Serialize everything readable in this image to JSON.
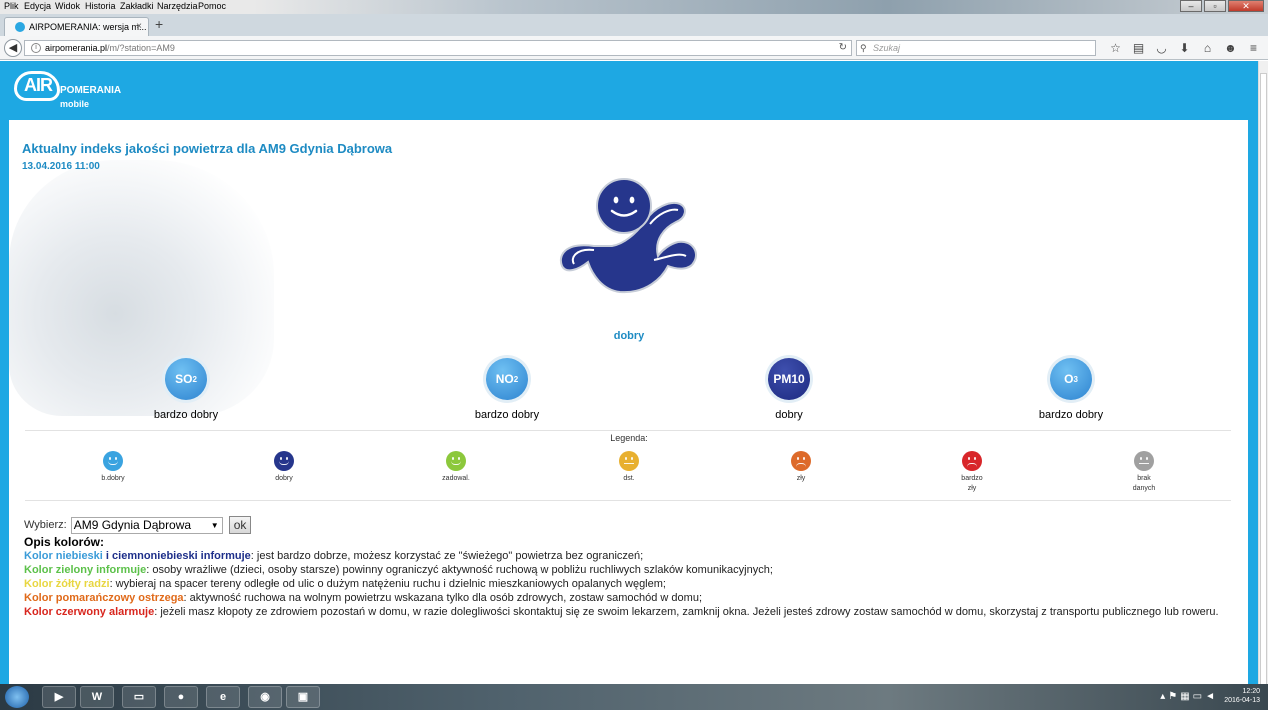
{
  "menubar": {
    "items": [
      "Plik",
      "Edycja",
      "Widok",
      "Historia",
      "Zakładki",
      "Narzędzia",
      "Pomoc"
    ]
  },
  "tab": {
    "title": "AIRPOMERANIA: wersja m...",
    "close": "×",
    "new": "+"
  },
  "address": {
    "host": "airpomerania.pl",
    "path": "/m/?station=AM9"
  },
  "search": {
    "placeholder": "Szukaj"
  },
  "logo": {
    "air": "AIR",
    "pomerania": "POMERANIA",
    "mobile": "mobile"
  },
  "page": {
    "title": "Aktualny indeks jakości powietrza dla AM9 Gdynia Dąbrowa",
    "date": "13.04.2016 11:00",
    "main_status": "dobry"
  },
  "pollutants": [
    {
      "name": "SO",
      "sub": "2",
      "status": "bardzo dobry",
      "level": "very-good"
    },
    {
      "name": "NO",
      "sub": "2",
      "status": "bardzo dobry",
      "level": "very-good"
    },
    {
      "name": "PM10",
      "sub": "",
      "status": "dobry",
      "level": "good"
    },
    {
      "name": "O",
      "sub": "3",
      "status": "bardzo dobry",
      "level": "very-good"
    }
  ],
  "legend": {
    "title": "Legenda:",
    "items": [
      {
        "label": "b.dobry",
        "label2": "",
        "color": "#3aa3e0"
      },
      {
        "label": "dobry",
        "label2": "",
        "color": "#26368c"
      },
      {
        "label": "zadowal.",
        "label2": "",
        "color": "#8cc83c"
      },
      {
        "label": "dst.",
        "label2": "",
        "color": "#e8b030"
      },
      {
        "label": "zły",
        "label2": "",
        "color": "#dd6a2a"
      },
      {
        "label": "bardzo",
        "label2": "zły",
        "color": "#d8262a"
      },
      {
        "label": "brak",
        "label2": "danych",
        "color": "#a0a0a0"
      }
    ]
  },
  "form": {
    "label": "Wybierz:",
    "selected": "AM9 Gdynia Dąbrowa",
    "ok": "ok"
  },
  "colors_heading": "Opis kolorów:",
  "descriptions": {
    "blue_a": "Kolor niebieski",
    "blue_b": "i ciemnoniebieski informuje",
    "blue_text": ": jest bardzo dobrze, możesz korzystać ze \"świeżego\" powietrza bez ograniczeń;",
    "green_a": "Kolor zielony informuje",
    "green_text": ": osoby wrażliwe (dzieci, osoby starsze) powinny ograniczyć aktywność ruchową w pobliżu ruchliwych szlaków komunikacyjnych;",
    "yellow_a": "Kolor żółty radzi",
    "yellow_text": ": wybieraj na spacer tereny odległe od ulic o dużym natężeniu ruchu i dzielnic mieszkaniowych opalanych węglem;",
    "orange_a": "Kolor pomarańczowy ostrzega",
    "orange_text": ": aktywność ruchowa na wolnym powietrzu wskazana tylko dla osób zdrowych, zostaw samochód w domu;",
    "red_a": "Kolor czerwony alarmuje",
    "red_text": ": jeżeli masz kłopoty ze zdrowiem pozostań w domu, w razie dolegliwości skontaktuj się ze swoim lekarzem, zamknij okna. Jeżeli jesteś zdrowy zostaw samochód w domu, skorzystaj z transportu publicznego lub roweru."
  },
  "taskbar": {
    "time": "12:20",
    "date": "2016-04-13"
  }
}
